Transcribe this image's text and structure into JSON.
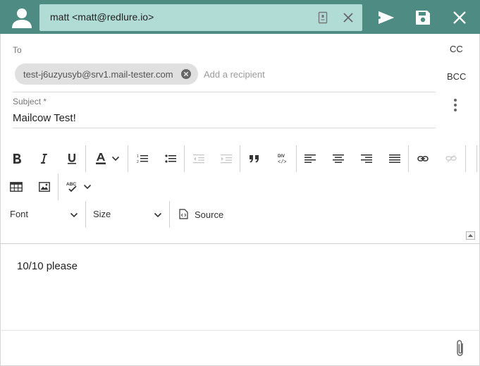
{
  "header": {
    "from": "matt <matt@redlure.io>",
    "icons": [
      "person-icon",
      "identity-card-icon",
      "clear-icon",
      "send-icon",
      "save-icon",
      "close-icon"
    ]
  },
  "recipients": {
    "to_label": "To",
    "chip": "test-j6uzyusyb@srv1.mail-tester.com",
    "add_placeholder": "Add a recipient",
    "cc_label": "CC",
    "bcc_label": "BCC"
  },
  "subject": {
    "label": "Subject *",
    "value": "Mailcow Test!"
  },
  "editor_toolbar": {
    "font_label": "Font",
    "size_label": "Size",
    "source_label": "Source",
    "spellcheck_text": "ABC"
  },
  "body": {
    "text": "10/10 please"
  },
  "colors": {
    "header_bg": "#4e8c83",
    "from_bg": "#b1dbd5",
    "chip_bg": "#e0e0e0"
  }
}
